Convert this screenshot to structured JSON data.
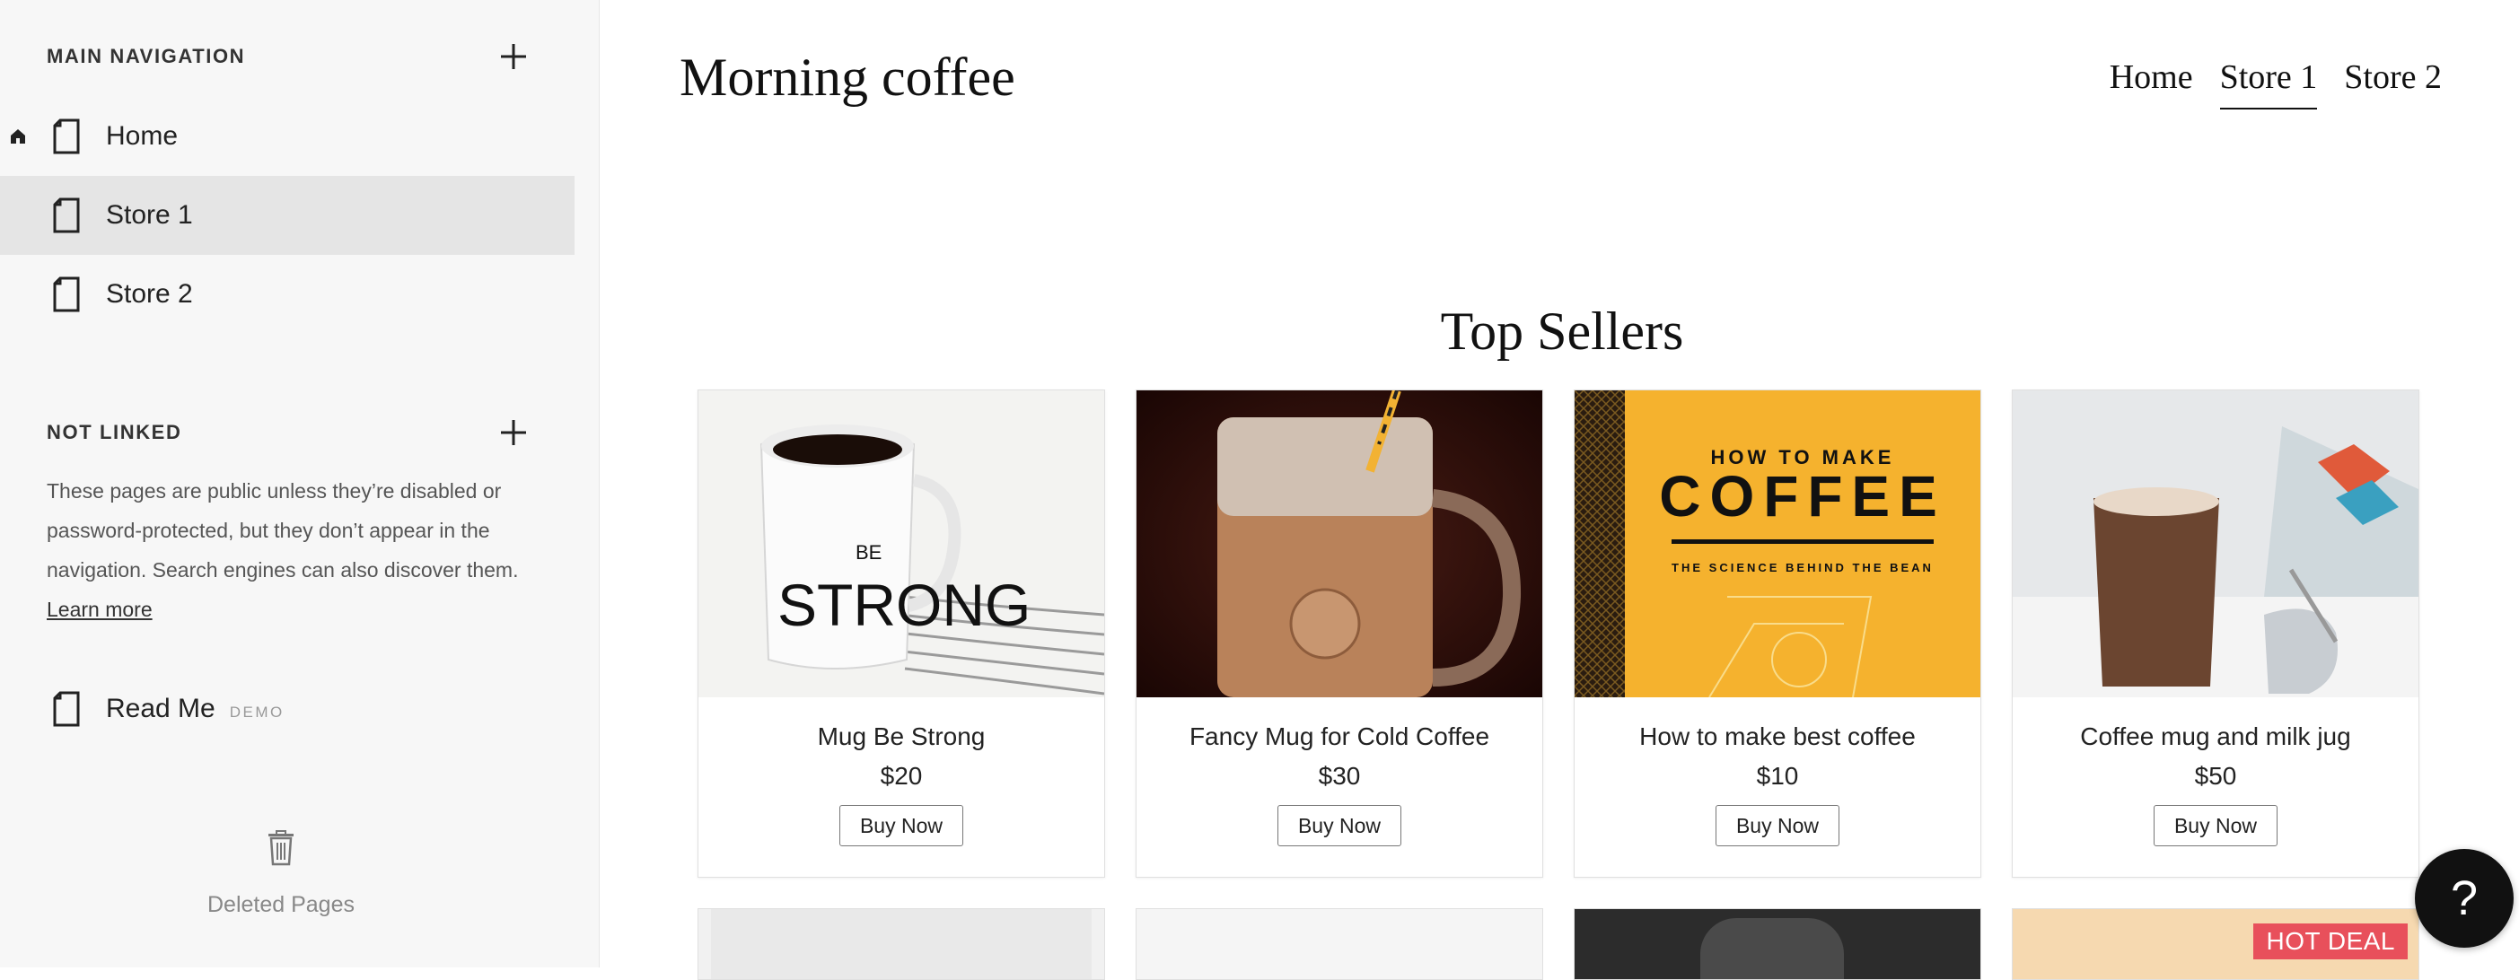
{
  "sidebar": {
    "main_nav_title": "MAIN NAVIGATION",
    "items": [
      {
        "label": "Home",
        "is_homepage": true
      },
      {
        "label": "Store 1",
        "active": true
      },
      {
        "label": "Store 2"
      }
    ],
    "not_linked_title": "NOT LINKED",
    "not_linked_desc": "These pages are public unless they’re disabled or password-protected, but they don’t appear in the navigation. Search engines can also discover them.",
    "learn_more": "Learn more",
    "unlinked_items": [
      {
        "label": "Read Me",
        "tag": "DEMO"
      }
    ],
    "deleted_pages": "Deleted Pages"
  },
  "site": {
    "title": "Morning coffee",
    "nav": [
      "Home",
      "Store 1",
      "Store 2"
    ],
    "active_nav": "Store 1",
    "section_heading": "Top Sellers",
    "products": [
      {
        "name": "Mug Be Strong",
        "price": "$20",
        "button": "Buy Now",
        "image": "white-mug-be-strong"
      },
      {
        "name": "Fancy Mug for Cold Coffee",
        "price": "$30",
        "button": "Buy Now",
        "image": "iced-coffee-mason-jar"
      },
      {
        "name": "How to make best coffee",
        "price": "$10",
        "button": "Buy Now",
        "image": "coffee-book-cover"
      },
      {
        "name": "Coffee mug and milk jug",
        "price": "$50",
        "button": "Buy Now",
        "image": "latte-glass-milk-jug"
      }
    ],
    "book_cover": {
      "line1": "HOW TO MAKE",
      "line2": "COFFEE",
      "line3": "THE SCIENCE BEHIND THE BEAN"
    },
    "mug_text": {
      "line1": "BE",
      "line2": "STRONG"
    },
    "hot_deal": "HOT DEAL"
  },
  "help_button": "?",
  "colors": {
    "sidebar_bg": "#f7f7f7",
    "active_item_bg": "#e5e5e5",
    "hot_deal": "#e8505b",
    "book_yellow": "#f5b22e"
  }
}
